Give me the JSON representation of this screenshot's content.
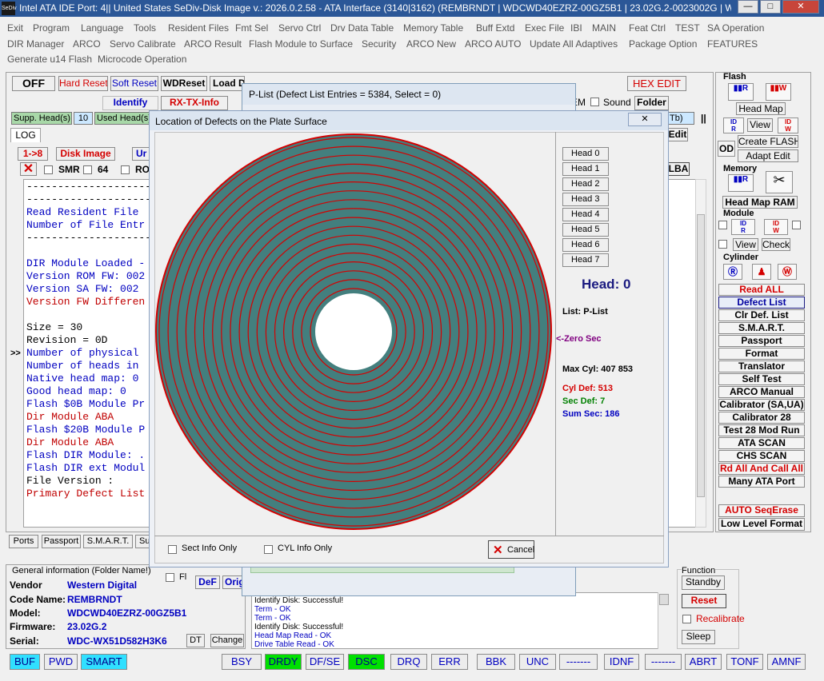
{
  "title_bar": {
    "text": "Intel ATA IDE  Port: 4|| United States  SeDiv-Disk Image v.: 2026.0.2.58 - ATA Interface (3140|3162)  (REMBRNDT | WDCWD40EZRZ-00GZ5B1 | 23.02G.2-0023002G | WD...",
    "icon_text": "SeDiv",
    "minimize": "—",
    "maximize": "□",
    "close": "✕"
  },
  "menu": {
    "row1": [
      "Exit",
      "Program",
      "Language",
      "Tools",
      "Resident Files",
      "Fmt Sel",
      "Servo Ctrl",
      "Drv Data Table",
      "Memory Table",
      "Buff Extd",
      "Exec File",
      "IBI",
      "MAIN",
      "Feat Ctrl",
      "TEST",
      "SA Operation"
    ],
    "row2": [
      "DIR Manager",
      "ARCO",
      "Servo Calibrate",
      "ARCO Result",
      "Flash Module to Surface",
      "Security",
      "ARCO New",
      "ARCO AUTO",
      "Update All Adaptives",
      "Package Option",
      "FEATURES"
    ],
    "row3": [
      "Generate u14 Flash",
      "Microcode Operation"
    ]
  },
  "toolbar": {
    "off": "OFF",
    "hard_reset": "Hard Reset",
    "soft_reset": "Soft Reset",
    "wdreset": "WDReset",
    "load_d": "Load D",
    "identify": "Identify",
    "rx_tx_info": "RX-TX-Info",
    "hex_edit": "HEX EDIT",
    "folder": "Folder",
    "sound": "Sound",
    "em": "EM",
    "supp_heads": "Supp. Head(s)",
    "supp_heads_val": "10",
    "used_heads": "Used Head(s)",
    "tb": "Tb)",
    "edit": "Edit",
    "lba": "LBA",
    "log_tab": "LOG",
    "one_to_8": "1->8",
    "disk_image": "Disk Image",
    "ur": "Ur",
    "smr": "SMR",
    "n64": "64",
    "ro": "RO"
  },
  "log_lines": [
    {
      "text": "-----------------------------",
      "color": "black"
    },
    {
      "text": "-----------------------------",
      "color": "black"
    },
    {
      "text": "Read Resident File",
      "color": "blue"
    },
    {
      "text": "Number of File Entr",
      "color": "blue"
    },
    {
      "text": "-----------------------------",
      "color": "black"
    },
    {
      "text": "",
      "color": "black"
    },
    {
      "text": "DIR Module Loaded -",
      "color": "blue"
    },
    {
      "text": "Version ROM FW: 002",
      "color": "blue"
    },
    {
      "text": "Version  SA FW: 002",
      "color": "blue"
    },
    {
      "text": "Version FW Differen",
      "color": "red"
    },
    {
      "text": "",
      "color": "black"
    },
    {
      "text": "Size = 30",
      "color": "black"
    },
    {
      "text": "Revision = 0D",
      "color": "black"
    },
    {
      "text": "Number of physical",
      "color": "blue"
    },
    {
      "text": "Number of heads in",
      "color": "blue"
    },
    {
      "text": "Native head map: 0",
      "color": "blue"
    },
    {
      "text": "Good head map: 0",
      "color": "blue"
    },
    {
      "text": "Flash $0B Module Pr",
      "color": "blue"
    },
    {
      "text": "   Dir Module ABA",
      "color": "red"
    },
    {
      "text": "Flash $20B Module P",
      "color": "blue"
    },
    {
      "text": "   Dir Module ABA",
      "color": "red"
    },
    {
      "text": "Flash DIR Module: .",
      "color": "blue"
    },
    {
      "text": "Flash DIR ext Modul",
      "color": "blue"
    },
    {
      "text": "File Version :",
      "color": "black"
    },
    {
      "text": "Primary Defect List",
      "color": "red"
    }
  ],
  "bottom_tabs": [
    "Ports",
    "Passport",
    "S.M.A.R.T.",
    "Su"
  ],
  "general_info": {
    "header": "General information (Folder Name!)",
    "fl": "Fl",
    "def": "DeF",
    "orig": "Orig",
    "vendor_label": "Vendor",
    "vendor": "Western Digital",
    "code_label": "Code Name:",
    "code": "REMBRNDT",
    "model_label": "Model:",
    "model": "WDCWD40EZRZ-00GZ5B1",
    "fw_label": "Firmware:",
    "fw": "23.02G.2",
    "serial_label": "Serial:",
    "serial": "WDC-WX51D582H3K6",
    "dt": "DT",
    "change": "Change"
  },
  "status_log": [
    {
      "text": "Identify Disk: Successful!",
      "color": "black"
    },
    {
      "text": "Term - OK",
      "color": "blue"
    },
    {
      "text": "Term - OK",
      "color": "blue"
    },
    {
      "text": "Identify Disk: Successful!",
      "color": "black"
    },
    {
      "text": "Head Map Read - OK",
      "color": "blue"
    },
    {
      "text": "Drive Table Read - OK",
      "color": "blue"
    }
  ],
  "function_box": {
    "label": "Function",
    "standby": "Standby",
    "reset": "Reset",
    "recalibrate": "Recalibrate",
    "sleep": "Sleep"
  },
  "right_panel": {
    "flash": "Flash",
    "head_map": "Head Map",
    "view": "View",
    "create_flash": "Create FLASH",
    "adapt_edit": "Adapt Edit",
    "od": "OD",
    "memory": "Memory",
    "head_map_ram": "Head Map RAM",
    "module": "Module",
    "view2": "View",
    "check": "Check",
    "cylinder": "Cylinder",
    "id_r": "ID R",
    "id_w": "ID W",
    "buttons": [
      {
        "label": "Read ALL",
        "color": "red",
        "style": "plain"
      },
      {
        "label": "Defect List",
        "color": "blue",
        "style": "sel"
      },
      {
        "label": "Clr Def. List",
        "color": "black",
        "style": "plain"
      },
      {
        "label": "S.M.A.R.T.",
        "color": "black",
        "style": "plain"
      },
      {
        "label": "Passport",
        "color": "black",
        "style": "plain"
      },
      {
        "label": "Format",
        "color": "black",
        "style": "plain"
      },
      {
        "label": "Translator",
        "color": "black",
        "style": "plain"
      },
      {
        "label": "Self Test",
        "color": "black",
        "style": "plain"
      },
      {
        "label": "ARCO Manual",
        "color": "black",
        "style": "plain"
      },
      {
        "label": "Calibrator (SA,UA)",
        "color": "black",
        "style": "plain"
      },
      {
        "label": "Calibrator 28",
        "color": "black",
        "style": "plain"
      },
      {
        "label": "Test 28 Mod Run",
        "color": "black",
        "style": "plain"
      },
      {
        "label": "ATA SCAN",
        "color": "black",
        "style": "plain"
      },
      {
        "label": "CHS SCAN",
        "color": "black",
        "style": "plain"
      },
      {
        "label": "Rd All And Call All",
        "color": "red",
        "style": "plain"
      },
      {
        "label": "Many ATA Port",
        "color": "black",
        "style": "plain"
      }
    ],
    "auto_seqerase": "AUTO SeqErase",
    "low_level_format": "Low Level Format"
  },
  "status_bar": [
    {
      "label": "BUF",
      "active": true
    },
    {
      "label": "PWD",
      "active": false
    },
    {
      "label": "SMART",
      "active": true
    },
    {
      "label": "BSY",
      "active": false
    },
    {
      "label": "DRDY",
      "active": true
    },
    {
      "label": "DF/SE",
      "active": false
    },
    {
      "label": "DSC",
      "active": true
    },
    {
      "label": "DRQ",
      "active": false
    },
    {
      "label": "ERR",
      "active": false
    },
    {
      "label": "BBK",
      "active": false
    },
    {
      "label": "UNC",
      "active": false
    },
    {
      "label": "-------",
      "active": false
    },
    {
      "label": "IDNF",
      "active": false
    },
    {
      "label": "-------",
      "active": false
    },
    {
      "label": "ABRT",
      "active": false
    },
    {
      "label": "TONF",
      "active": false
    },
    {
      "label": "AMNF",
      "active": false
    }
  ],
  "plist_window": {
    "title": "P-List (Defect List Entries = 5384, Select = 0)"
  },
  "defects_dialog": {
    "title": "Location of Defects on the Plate Surface",
    "close": "✕",
    "heads": [
      "Head 0",
      "Head 1",
      "Head 2",
      "Head 3",
      "Head 4",
      "Head 5",
      "Head 6",
      "Head 7"
    ],
    "head_display": "Head: 0",
    "list": "List: P-List",
    "zero_sec": "<-Zero Sec",
    "max_cyl": "Max Cyl: 407 853",
    "cyl_def": "Cyl Def: 513",
    "sec_def": "Sec Def: 7",
    "sum_sec": "Sum Sec: 186",
    "sect_info_only": "Sect Info Only",
    "cyl_info_only": "CYL Info Only",
    "cancel": "Cancel",
    "platter_color": "#437f7e",
    "ring_color": "#d40000",
    "ring_count": 18
  }
}
